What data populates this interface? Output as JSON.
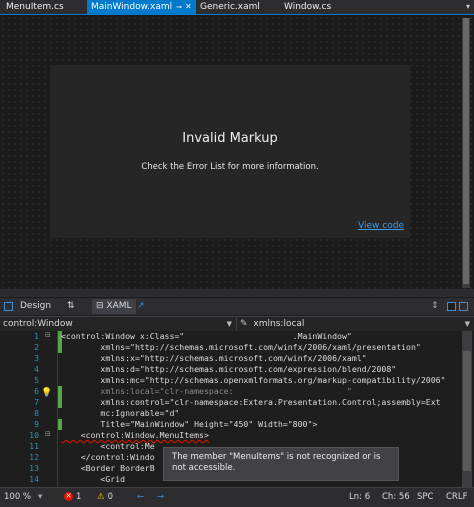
{
  "tabs": [
    {
      "label": "MenuItem.cs",
      "active": false
    },
    {
      "label": "MainWindow.xaml",
      "active": true
    },
    {
      "label": "Generic.xaml",
      "active": false
    },
    {
      "label": "Window.cs",
      "active": false
    }
  ],
  "designer": {
    "title": "Invalid Markup",
    "message": "Check the Error List for more information.",
    "view_code": "View code"
  },
  "modes": {
    "design": "Design",
    "swap": "⇅",
    "xaml": "XAML"
  },
  "nav": {
    "left": "control:Window",
    "right": "xmlns:local"
  },
  "code_lines": [
    {
      "num": "1",
      "text": "<control:Window x:Class=\"                      .MainWindow\""
    },
    {
      "num": "2",
      "text": "        xmlns=\"http://schemas.microsoft.com/winfx/2006/xaml/presentation\""
    },
    {
      "num": "3",
      "text": "        xmlns:x=\"http://schemas.microsoft.com/winfx/2006/xaml\""
    },
    {
      "num": "4",
      "text": "        xmlns:d=\"http://schemas.microsoft.com/expression/blend/2008\""
    },
    {
      "num": "5",
      "text": "        xmlns:mc=\"http://schemas.openxmlformats.org/markup-compatibility/2006\""
    },
    {
      "num": "6",
      "text": "        xmlns:local=\"clr-namespace:                       \""
    },
    {
      "num": "7",
      "text": "        xmlns:control=\"clr-namespace:Extera.Presentation.Control;assembly=Ext"
    },
    {
      "num": "8",
      "text": "        mc:Ignorable=\"d\""
    },
    {
      "num": "9",
      "text": "        Title=\"MainWindow\" Height=\"450\" Width=\"800\">"
    },
    {
      "num": "10",
      "text": "    <control:Window.MenuItems>"
    },
    {
      "num": "11",
      "text": "        <control:Me"
    },
    {
      "num": "12",
      "text": "    </control:Windo"
    },
    {
      "num": "13",
      "text": "    <Border BorderB"
    },
    {
      "num": "14",
      "text": "        <Grid"
    }
  ],
  "tooltip": "The member \"MenuItems\" is not recognized or is not accessible.",
  "status": {
    "zoom": "100 %",
    "errors": "1",
    "warnings": "0",
    "ln": "Ln: 6",
    "ch": "Ch: 56",
    "spc": "SPC",
    "crlf": "CRLF"
  },
  "colors": {
    "accent": "#007acc",
    "link": "#3f9cf0",
    "line_number": "#2b91af",
    "error": "#e51400",
    "warning": "#f0c000"
  }
}
